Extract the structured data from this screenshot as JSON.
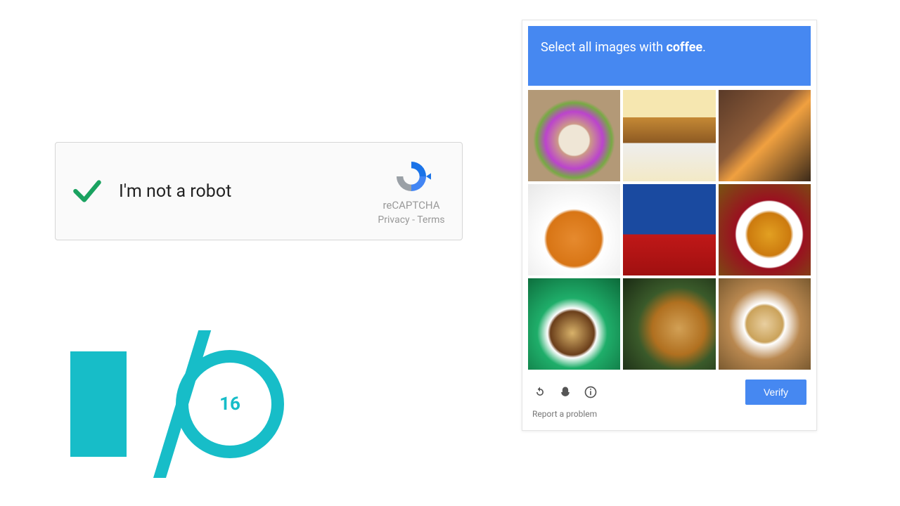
{
  "recaptcha": {
    "label": "I'm not a robot",
    "badge_title": "reCAPTCHA",
    "privacy": "Privacy",
    "terms": "Terms",
    "link_separator": " - "
  },
  "io_logo": {
    "year": "16"
  },
  "challenge": {
    "prompt_prefix": "Select all images with ",
    "target_word": "coffee",
    "prompt_suffix": ".",
    "verify_label": "Verify",
    "report_label": "Report a problem",
    "tiles": [
      {
        "name": "tile-1"
      },
      {
        "name": "tile-2"
      },
      {
        "name": "tile-3"
      },
      {
        "name": "tile-4"
      },
      {
        "name": "tile-5"
      },
      {
        "name": "tile-6"
      },
      {
        "name": "tile-7"
      },
      {
        "name": "tile-8"
      },
      {
        "name": "tile-9"
      }
    ]
  }
}
